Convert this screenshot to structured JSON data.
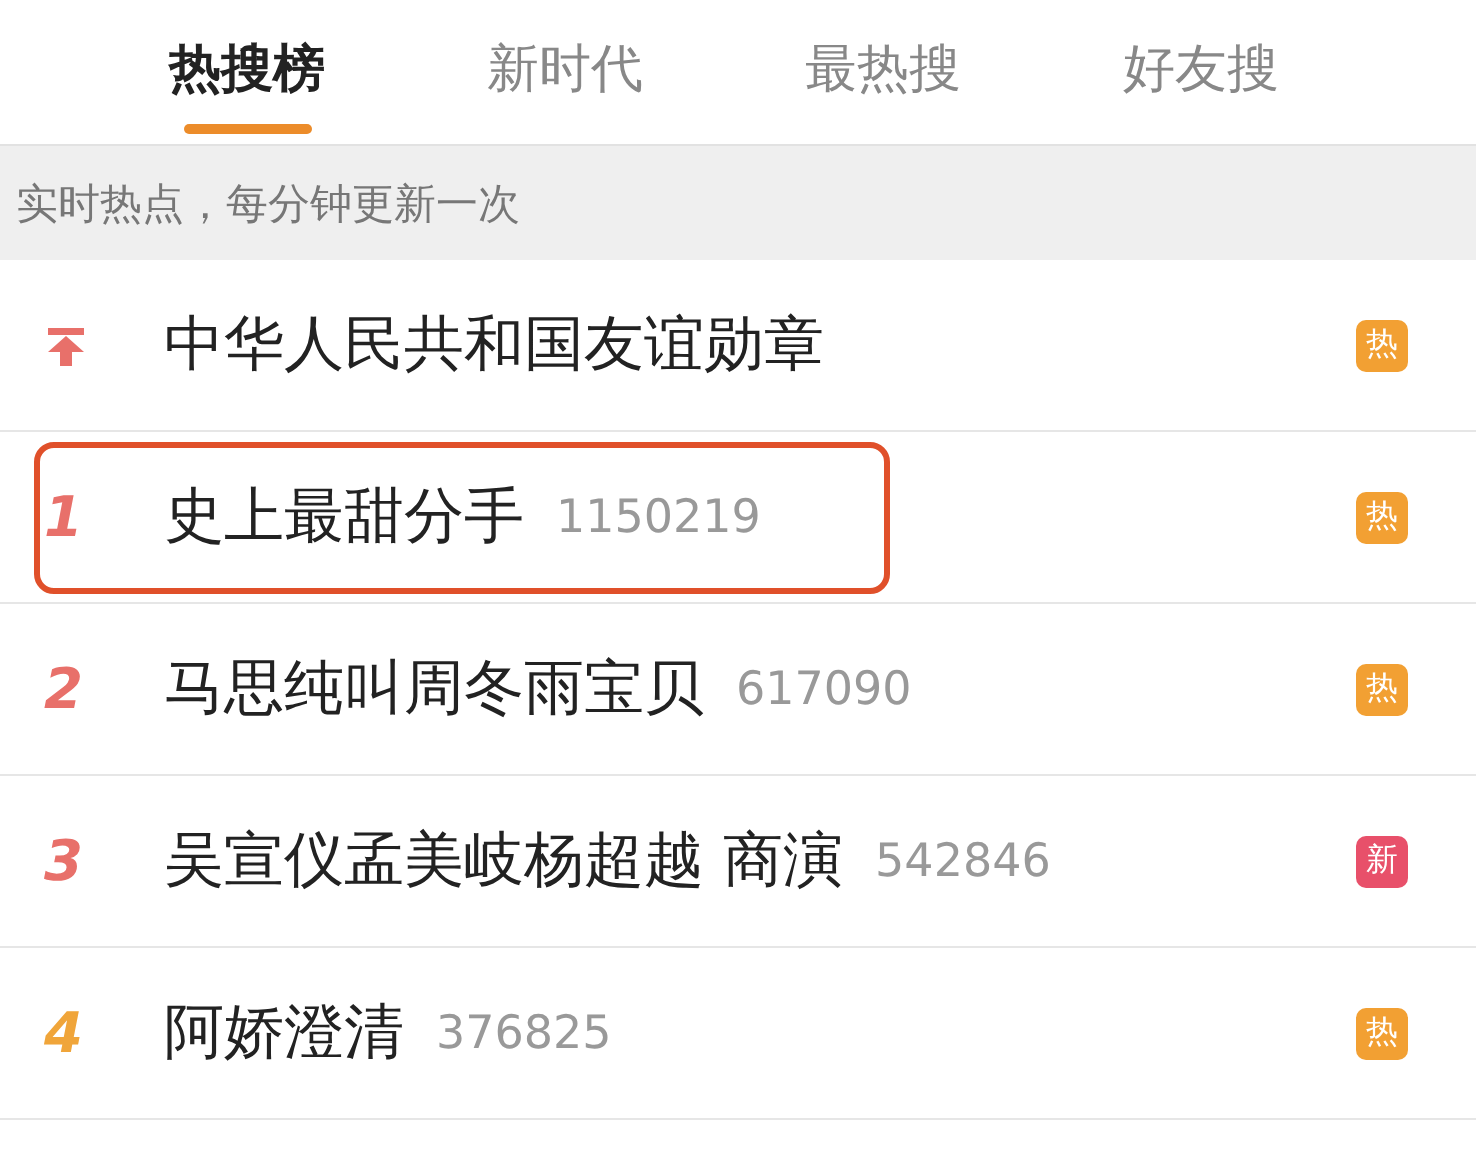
{
  "tabs": [
    {
      "label": "热搜榜",
      "selected": true
    },
    {
      "label": "新时代",
      "selected": false
    },
    {
      "label": "最热搜",
      "selected": false
    },
    {
      "label": "好友搜",
      "selected": false
    }
  ],
  "notice": "实时热点，每分钟更新一次",
  "items": [
    {
      "kind": "pinned",
      "title": "中华人民共和国友谊勋章",
      "badge": {
        "text": "热",
        "color": "#f2a033"
      },
      "highlighted": false
    },
    {
      "kind": "rank",
      "rank": "1",
      "color": "#e8706a",
      "title": "史上最甜分手",
      "count": "1150219",
      "badge": {
        "text": "热",
        "color": "#f2a033"
      },
      "highlighted": true
    },
    {
      "kind": "rank",
      "rank": "2",
      "color": "#e8706a",
      "title": "马思纯叫周冬雨宝贝",
      "count": "617090",
      "badge": {
        "text": "热",
        "color": "#f2a033"
      },
      "highlighted": false
    },
    {
      "kind": "rank",
      "rank": "3",
      "color": "#e8706a",
      "title": "吴宣仪孟美岐杨超越 商演",
      "count": "542846",
      "badge": {
        "text": "新",
        "color": "#e8506a"
      },
      "highlighted": false
    },
    {
      "kind": "rank",
      "rank": "4",
      "color": "#f0a53a",
      "title": "阿娇澄清",
      "count": "376825",
      "badge": {
        "text": "热",
        "color": "#f2a033"
      },
      "highlighted": false
    }
  ]
}
